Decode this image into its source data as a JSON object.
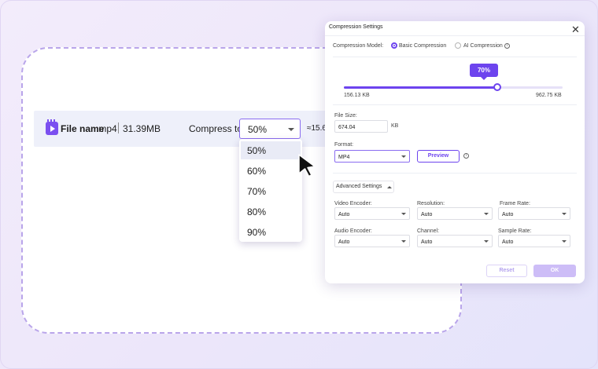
{
  "file": {
    "name": "File name",
    "ext": ".mp4",
    "size": "31.39MB",
    "compress_label": "Compress to",
    "compress_value": "50%",
    "estimate": "≈15.6"
  },
  "dropdown": {
    "options": [
      "50%",
      "60%",
      "70%",
      "80%",
      "90%"
    ],
    "selected": "50%"
  },
  "panel": {
    "title": "Compression Settings",
    "mode_label": "Compression Model:",
    "mode_basic": "Basic Compression",
    "mode_ai": "AI Compression",
    "mode_selected": "Basic Compression",
    "slider": {
      "value_label": "70%",
      "fraction": 0.7,
      "min_label": "156.13 KB",
      "max_label": "962.75 KB"
    },
    "file_size": {
      "label": "File Size:",
      "value": "674.04",
      "unit": "KB"
    },
    "format": {
      "label": "Format:",
      "value": "MP4",
      "preview_label": "Preview"
    },
    "advanced_label": "Advanced Settings",
    "settings": [
      {
        "label": "Video Encoder:",
        "value": "Auto"
      },
      {
        "label": "Resolution:",
        "value": "Auto"
      },
      {
        "label": "Frame Rate:",
        "value": "Auto"
      },
      {
        "label": "Audio Encoder:",
        "value": "Auto"
      },
      {
        "label": "Channel:",
        "value": "Auto"
      },
      {
        "label": "Sample Rate:",
        "value": "Auto"
      }
    ],
    "reset_label": "Reset",
    "ok_label": "OK"
  },
  "colors": {
    "accent": "#6d44ee",
    "dashed_border": "#b9a5ea",
    "ok_disabled": "#cdbdf7"
  },
  "icons": {
    "file": "video-file-icon",
    "close": "close-icon",
    "info": "info-icon",
    "cursor": "mouse-pointer-icon"
  }
}
